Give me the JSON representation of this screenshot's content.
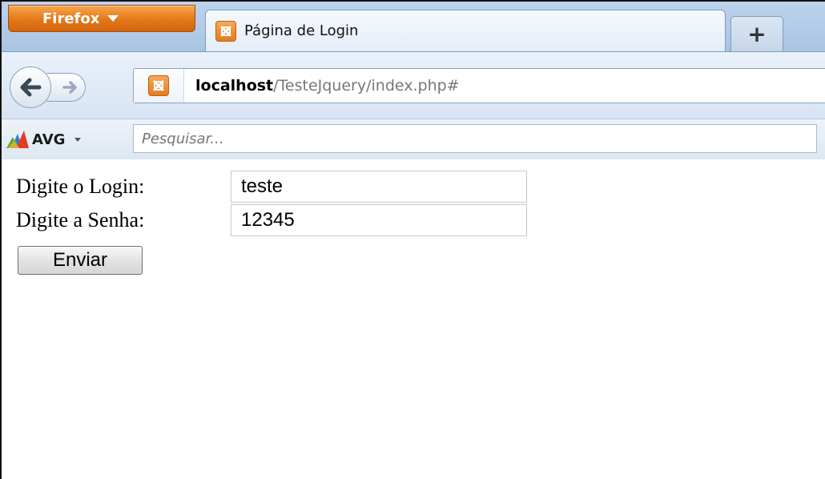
{
  "browser": {
    "menu_label": "Firefox",
    "tab_title": "Página de Login",
    "new_tab_label": "+",
    "url_host": "localhost",
    "url_path": "/TesteJquery/index.php#"
  },
  "avg_toolbar": {
    "brand": "AVG",
    "search_placeholder": "Pesquisar..."
  },
  "form": {
    "login_label": "Digite o Login:",
    "login_value": "teste",
    "password_label": "Digite a Senha:",
    "password_value": "12345",
    "submit_label": "Enviar"
  },
  "colors": {
    "firefox_orange": "#e2781a",
    "chrome_blue": "#bcd3ec",
    "avg_red": "#e23b24",
    "avg_green": "#4caf2f"
  },
  "icons": [
    "xampp-favicon-icon",
    "back-arrow-icon",
    "forward-arrow-icon",
    "avg-logo-icon",
    "dropdown-caret-icon"
  ]
}
